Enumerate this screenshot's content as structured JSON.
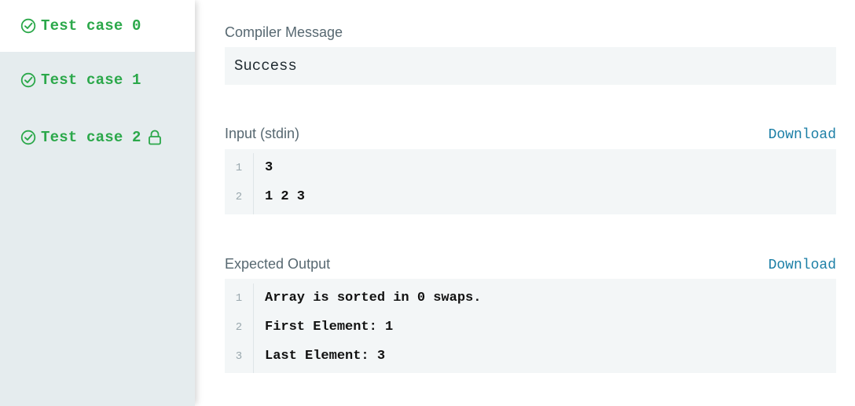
{
  "sidebar": {
    "tabs": [
      {
        "label": "Test case 0",
        "icon": "check-circle-icon",
        "active": true
      },
      {
        "label": "Test case 1",
        "icon": "check-circle-icon",
        "active": false
      },
      {
        "label": "Test case 2",
        "icon": "check-circle-icon",
        "active": false,
        "locked": true
      }
    ]
  },
  "compiler": {
    "title": "Compiler Message",
    "message": "Success"
  },
  "input": {
    "title": "Input (stdin)",
    "download_label": "Download",
    "lines": [
      {
        "num": "1",
        "text": "3"
      },
      {
        "num": "2",
        "text": "1 2 3"
      }
    ]
  },
  "expected": {
    "title": "Expected Output",
    "download_label": "Download",
    "lines": [
      {
        "num": "1",
        "text": "Array is sorted in 0 swaps."
      },
      {
        "num": "2",
        "text": "First Element: 1"
      },
      {
        "num": "3",
        "text": "Last Element: 3"
      }
    ]
  },
  "colors": {
    "success": "#2ba84a",
    "link": "#1c7fa6",
    "sidebar_bg": "#e5ecee",
    "code_bg": "#f3f6f7"
  }
}
